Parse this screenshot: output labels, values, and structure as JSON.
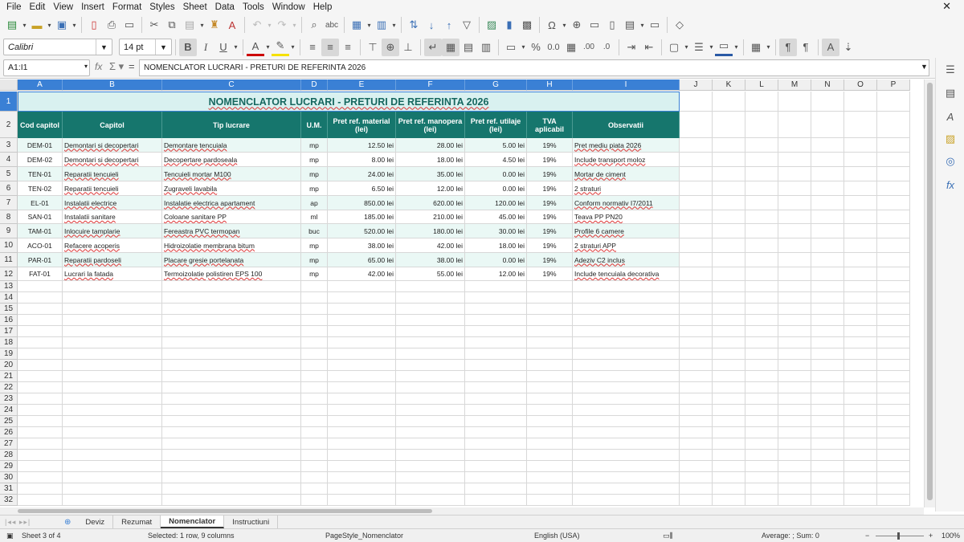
{
  "menu": [
    "File",
    "Edit",
    "View",
    "Insert",
    "Format",
    "Styles",
    "Sheet",
    "Data",
    "Tools",
    "Window",
    "Help"
  ],
  "toolbar": {
    "font_name": "Calibri",
    "font_size": "14 pt"
  },
  "formula_bar": {
    "cell_ref": "A1:I1",
    "content": "NOMENCLATOR LUCRARI - PRETURI DE REFERINTA 2026"
  },
  "columns": [
    "A",
    "B",
    "C",
    "D",
    "E",
    "F",
    "G",
    "H",
    "I",
    "J",
    "K",
    "L",
    "M",
    "N",
    "O",
    "P"
  ],
  "rows": [
    "1",
    "2",
    "3",
    "4",
    "5",
    "6",
    "7",
    "8",
    "9",
    "10",
    "11",
    "12",
    "13",
    "14",
    "15",
    "16",
    "17",
    "18",
    "19",
    "20",
    "21",
    "22",
    "23",
    "24",
    "25",
    "26",
    "27",
    "28",
    "29",
    "30",
    "31",
    "32"
  ],
  "sheet": {
    "title": "NOMENCLATOR LUCRARI - PRETURI DE REFERINTA 2026",
    "headers": [
      "Cod capitol",
      "Capitol",
      "Tip lucrare",
      "U.M.",
      "Pret ref. material (lei)",
      "Pret ref. manopera (lei)",
      "Pret ref. utilaje (lei)",
      "TVA aplicabil",
      "Observatii"
    ],
    "data": [
      [
        "DEM-01",
        "Demontari si decopertari",
        "Demontare tencuiala",
        "mp",
        "12.50 lei",
        "28.00 lei",
        "5.00 lei",
        "19%",
        "Pret mediu piata 2026"
      ],
      [
        "DEM-02",
        "Demontari si decopertari",
        "Decopertare pardoseala",
        "mp",
        "8.00 lei",
        "18.00 lei",
        "4.50 lei",
        "19%",
        "Include transport moloz"
      ],
      [
        "TEN-01",
        "Reparatii tencuieli",
        "Tencuieli mortar M100",
        "mp",
        "24.00 lei",
        "35.00 lei",
        "0.00 lei",
        "19%",
        "Mortar de ciment"
      ],
      [
        "TEN-02",
        "Reparatii tencuieli",
        "Zugraveli lavabila",
        "mp",
        "6.50 lei",
        "12.00 lei",
        "0.00 lei",
        "19%",
        "2 straturi"
      ],
      [
        "EL-01",
        "Instalatii electrice",
        "Instalatie electrica apartament",
        "ap",
        "850.00 lei",
        "620.00 lei",
        "120.00 lei",
        "19%",
        "Conform normativ I7/2011"
      ],
      [
        "SAN-01",
        "Instalatii sanitare",
        "Coloane sanitare PP",
        "ml",
        "185.00 lei",
        "210.00 lei",
        "45.00 lei",
        "19%",
        "Teava PP PN20"
      ],
      [
        "TAM-01",
        "Inlocuire tamplarie",
        "Fereastra PVC termopan",
        "buc",
        "520.00 lei",
        "180.00 lei",
        "30.00 lei",
        "19%",
        "Profile 6 camere"
      ],
      [
        "ACO-01",
        "Refacere acoperis",
        "Hidroizolatie membrana bitum",
        "mp",
        "38.00 lei",
        "42.00 lei",
        "18.00 lei",
        "19%",
        "2 straturi APP"
      ],
      [
        "PAR-01",
        "Reparatii pardoseli",
        "Placare gresie portelanata",
        "mp",
        "65.00 lei",
        "38.00 lei",
        "0.00 lei",
        "19%",
        "Adeziv C2 inclus"
      ],
      [
        "FAT-01",
        "Lucrari la fatada",
        "Termoizolatie polistiren EPS 100",
        "mp",
        "42.00 lei",
        "55.00 lei",
        "12.00 lei",
        "19%",
        "Include tencuiala decorativa"
      ]
    ]
  },
  "tabs": [
    "Deviz",
    "Rezumat",
    "Nomenclator",
    "Instructiuni"
  ],
  "status": {
    "sheet": "Sheet 3 of 4",
    "selection": "Selected: 1 row, 9 columns",
    "page_style": "PageStyle_Nomenclator",
    "language": "English (USA)",
    "summary": "Average: ; Sum: 0",
    "zoom": "100%"
  },
  "colors": {
    "header_bg": "#16766d",
    "title_bg": "#d9f1f0",
    "title_text": "#16675f",
    "selection": "#3a80d5"
  }
}
